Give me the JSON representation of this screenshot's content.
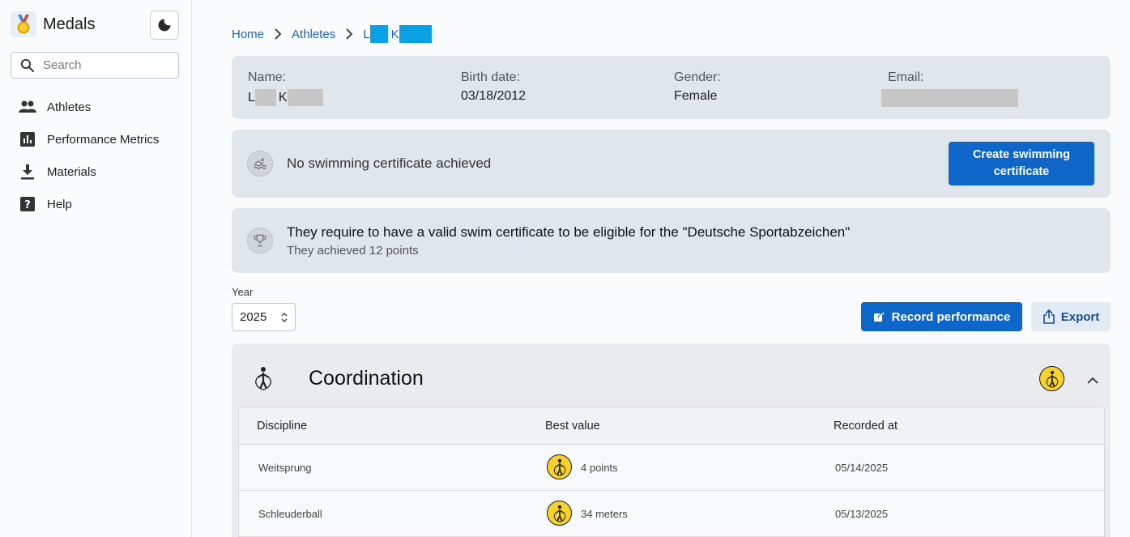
{
  "app": {
    "name": "Medals"
  },
  "search": {
    "placeholder": "Search"
  },
  "nav": [
    {
      "label": "Athletes",
      "icon": "people-icon"
    },
    {
      "label": "Performance Metrics",
      "icon": "bar-chart-icon"
    },
    {
      "label": "Materials",
      "icon": "download-icon"
    },
    {
      "label": "Help",
      "icon": "help-icon"
    }
  ],
  "breadcrumb": {
    "home": "Home",
    "athletes": "Athletes",
    "current_initial_1": "L",
    "current_initial_2": "K"
  },
  "athlete": {
    "name_label": "Name:",
    "name_initial_1": "L",
    "name_initial_2": "K",
    "birth_label": "Birth date:",
    "birth_value": "03/18/2012",
    "gender_label": "Gender:",
    "gender_value": "Female",
    "email_label": "Email:"
  },
  "certificate": {
    "status_text": "No swimming certificate achieved",
    "button_label": "Create swimming certificate"
  },
  "requirement": {
    "title": "They require to have a valid swim certificate to be eligible for the \"Deutsche Sportabzeichen\"",
    "subtitle": "They achieved 12 points"
  },
  "year": {
    "label": "Year",
    "value": "2025"
  },
  "actions": {
    "record_label": "Record performance",
    "export_label": "Export"
  },
  "section": {
    "title": "Coordination",
    "columns": [
      "Discipline",
      "Best value",
      "Recorded at"
    ],
    "rows": [
      {
        "discipline": "Weitsprung",
        "best_value": "4 points",
        "recorded_at": "05/14/2025"
      },
      {
        "discipline": "Schleuderball",
        "best_value": "34 meters",
        "recorded_at": "05/13/2025"
      }
    ]
  },
  "colors": {
    "primary": "#0e66c9",
    "card": "#dfe6ec",
    "medal": "#f7d22a",
    "mask_blue": "#0aa0e6",
    "mask_gray": "#c6c6c6"
  }
}
